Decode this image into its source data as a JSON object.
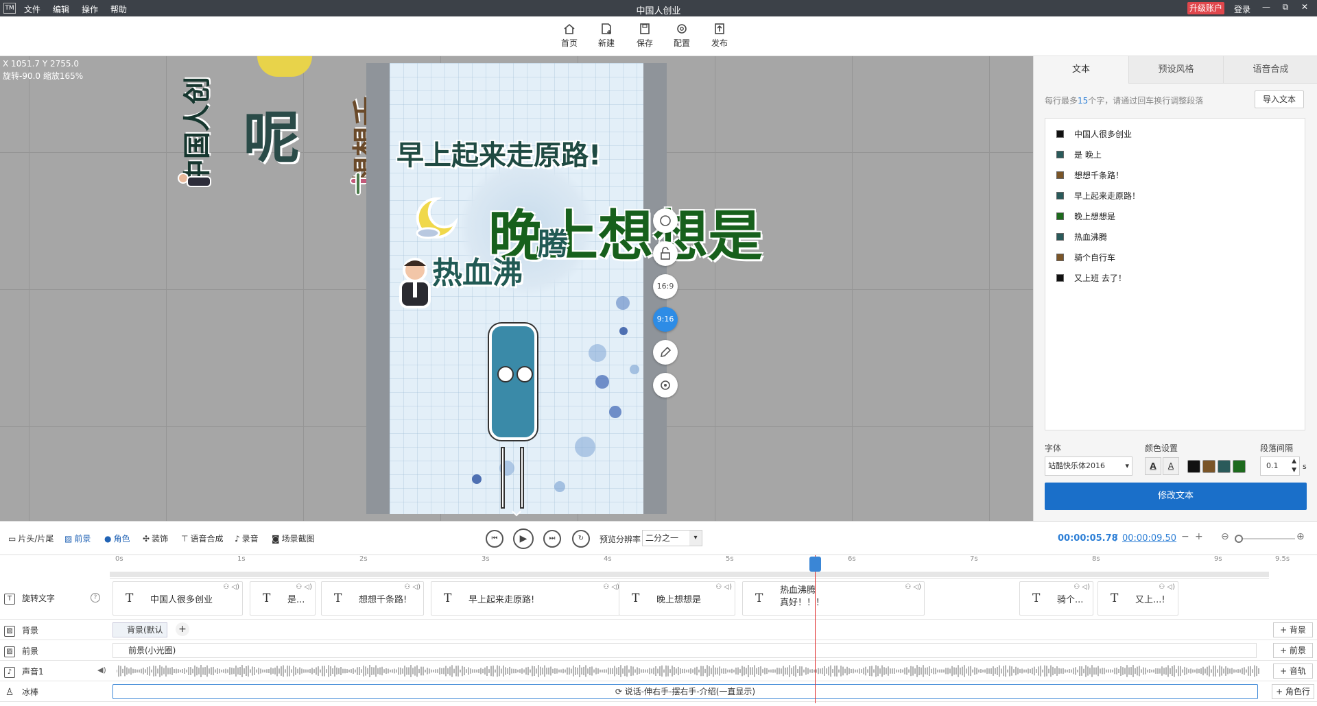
{
  "titlebar": {
    "logo": "TM",
    "menus": [
      "文件",
      "编辑",
      "操作",
      "帮助"
    ],
    "title": "中国人创业",
    "upgrade": "升级账户",
    "login": "登录",
    "win_min": "—",
    "win_restore": "⧉",
    "win_close": "✕"
  },
  "toolbar": {
    "home": "首页",
    "new": "新建",
    "save": "保存",
    "config": "配置",
    "publish": "发布"
  },
  "canvas": {
    "coords": "X 1051.7 Y 2755.0",
    "rotate_zoom": "旋转-90.0 缩放165%",
    "txt_zhongguoren": "中国人创",
    "txt_ni": "呢",
    "txt_xiangxiang": "想想千",
    "txt_zaoshang": "早上起来走原路!",
    "txt_wanshang": "晚上想想是",
    "txt_teng": "腾",
    "txt_rexuefei": "热血沸",
    "ratio_169": "16:9",
    "ratio_916": "9:16"
  },
  "rpanel": {
    "tabs": [
      "文本",
      "预设风格",
      "语音合成"
    ],
    "hint_prefix": "每行最多",
    "hint_num": "15",
    "hint_suffix": "个字，请通过回车换行调整段落",
    "import": "导入文本",
    "lines": [
      {
        "text": "中国人很多创业",
        "color": "#111111"
      },
      {
        "text": "是 晚上",
        "color": "#2a5a5a"
      },
      {
        "text": "想想千条路！",
        "color": "#7a5528"
      },
      {
        "text": "早上起来走原路！",
        "color": "#2a5a5a"
      },
      {
        "text": "  晚上想想是",
        "color": "#1d6a1d"
      },
      {
        "text": "热血沸腾",
        "color": "#2a5a5a"
      },
      {
        "text": "骑个自行车",
        "color": "#7a5528"
      },
      {
        "text": "又上班  去了！",
        "color": "#111111"
      }
    ],
    "font_label": "字体",
    "font_value": "站酷快乐体2016",
    "color_label": "颜色设置",
    "spacing_label": "段落间隔",
    "spacing_value": "0.1",
    "spacing_unit": "s",
    "swatches": [
      "#111111",
      "#7a5528",
      "#2a5a5a",
      "#1d6a1d"
    ],
    "modify": "修改文本"
  },
  "pbar": {
    "tabs": [
      "片头/片尾",
      "前景",
      "角色",
      "装饰",
      "语音合成",
      "录音",
      "场景截图"
    ],
    "res_label": "预览分辨率",
    "res_value": "二分之一",
    "time_current": "00:00:05.78",
    "time_sep": "/",
    "time_total": "00:00:09.50"
  },
  "ruler": [
    "0s",
    "1s",
    "2s",
    "3s",
    "4s",
    "5s",
    "6s",
    "7s",
    "8s",
    "9s",
    "9.5s"
  ],
  "tracks": {
    "text": {
      "label": "旋转文字",
      "clips": [
        "中国人很多创业",
        "是...",
        "想想千条路!",
        "早上起来走原路!",
        "晚上想想是",
        "热血沸腾\n真好！！！",
        "骑个...",
        "又上...!"
      ]
    },
    "bg": {
      "label": "背景",
      "clip": "背景(默认",
      "add": "+ 背景"
    },
    "fg": {
      "label": "前景",
      "clip": "前景(小光圈)",
      "add": "+ 前景"
    },
    "audio": {
      "label": "声音1",
      "add": "+ 音轨"
    },
    "role": {
      "label": "冰棒",
      "clip": "说话-伸右手-摆右手-介绍(一直显示)",
      "add": "+ 角色行"
    }
  }
}
